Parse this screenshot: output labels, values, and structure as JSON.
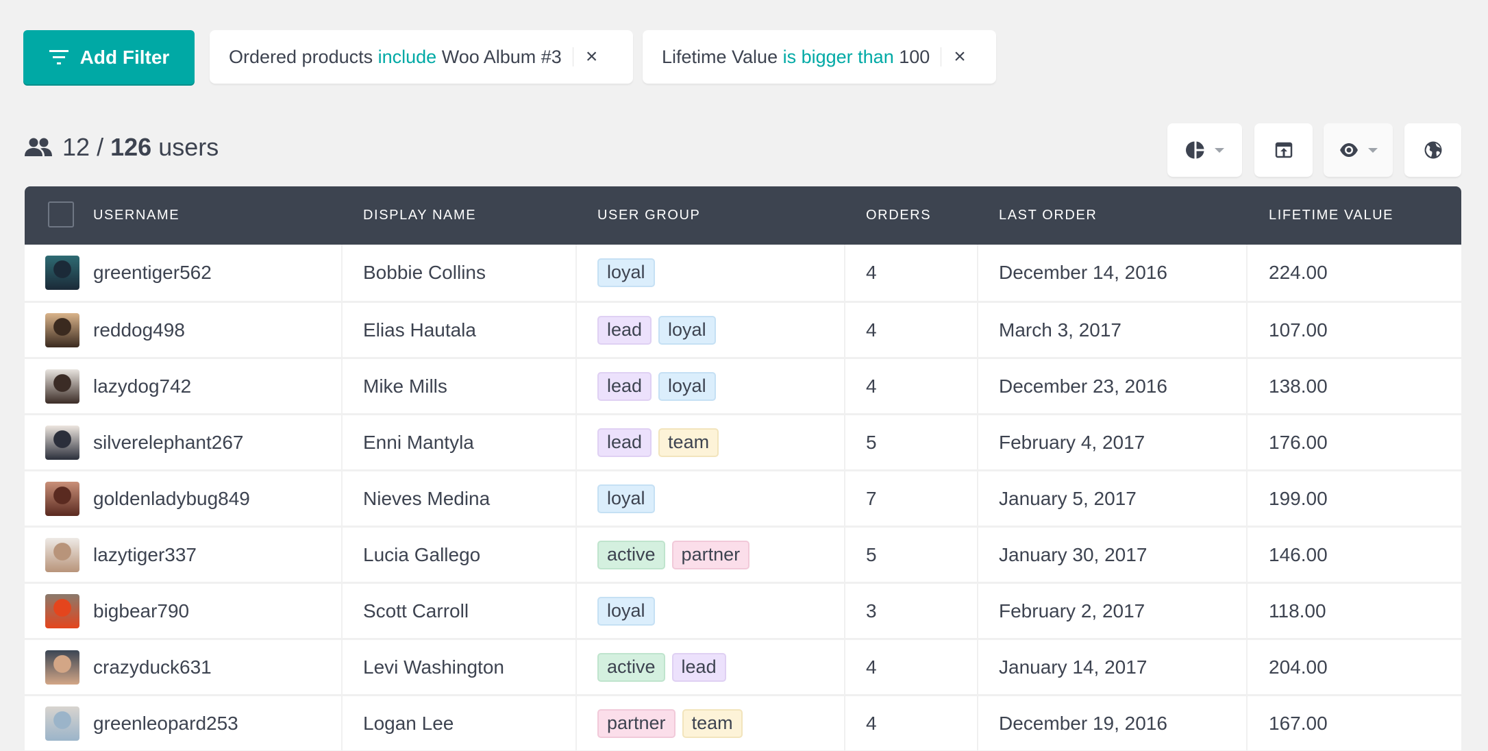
{
  "filter_bar": {
    "add_filter_label": "Add Filter",
    "filters": [
      {
        "field": "Ordered products",
        "operator": "include",
        "value": "Woo Album #3",
        "remove": "×"
      },
      {
        "field": "Lifetime Value",
        "operator": "is bigger than",
        "value": "100",
        "remove": "×"
      }
    ]
  },
  "summary": {
    "shown": "12",
    "separator": "/",
    "total": "126",
    "unit": "users"
  },
  "toolbar": [
    {
      "name": "segments-button",
      "icon": "pie-chart-icon",
      "has_dropdown": true
    },
    {
      "name": "export-button",
      "icon": "export-icon",
      "has_dropdown": false
    },
    {
      "name": "column-visibility-button",
      "icon": "eye-icon",
      "has_dropdown": true
    },
    {
      "name": "geolocation-button",
      "icon": "globe-icon",
      "has_dropdown": false
    }
  ],
  "colors": {
    "accent": "#00a9a5",
    "header_bg": "#3d4450",
    "text": "#3d4350",
    "tag_loyal": "#dbeefc",
    "tag_lead": "#ece1fc",
    "tag_team": "#fdf3d8",
    "tag_active": "#d4f0df",
    "tag_partner": "#fbdeea"
  },
  "table": {
    "columns": [
      "USERNAME",
      "DISPLAY NAME",
      "USER GROUP",
      "ORDERS",
      "LAST ORDER",
      "LIFETIME VALUE"
    ],
    "rows": [
      {
        "username": "greentiger562",
        "display_name": "Bobbie Collins",
        "groups": [
          "loyal"
        ],
        "orders": "4",
        "last_order": "December 14, 2016",
        "lifetime_value": "224.00",
        "avatar_colors": [
          "#2e6b73",
          "#1b2a38"
        ]
      },
      {
        "username": "reddog498",
        "display_name": "Elias Hautala",
        "groups": [
          "lead",
          "loyal"
        ],
        "orders": "4",
        "last_order": "March 3, 2017",
        "lifetime_value": "107.00",
        "avatar_colors": [
          "#d9b38a",
          "#3a2a1f"
        ]
      },
      {
        "username": "lazydog742",
        "display_name": "Mike Mills",
        "groups": [
          "lead",
          "loyal"
        ],
        "orders": "4",
        "last_order": "December 23, 2016",
        "lifetime_value": "138.00",
        "avatar_colors": [
          "#e8e4df",
          "#3b2c26"
        ]
      },
      {
        "username": "silverelephant267",
        "display_name": "Enni Mantyla",
        "groups": [
          "lead",
          "team"
        ],
        "orders": "5",
        "last_order": "February 4, 2017",
        "lifetime_value": "176.00",
        "avatar_colors": [
          "#ede6df",
          "#2b2f3b"
        ]
      },
      {
        "username": "goldenladybug849",
        "display_name": "Nieves Medina",
        "groups": [
          "loyal"
        ],
        "orders": "7",
        "last_order": "January 5, 2017",
        "lifetime_value": "199.00",
        "avatar_colors": [
          "#c98f78",
          "#5a2a20"
        ]
      },
      {
        "username": "lazytiger337",
        "display_name": "Lucia Gallego",
        "groups": [
          "active",
          "partner"
        ],
        "orders": "5",
        "last_order": "January 30, 2017",
        "lifetime_value": "146.00",
        "avatar_colors": [
          "#eeeae6",
          "#b8947a"
        ]
      },
      {
        "username": "bigbear790",
        "display_name": "Scott Carroll",
        "groups": [
          "loyal"
        ],
        "orders": "3",
        "last_order": "February 2, 2017",
        "lifetime_value": "118.00",
        "avatar_colors": [
          "#8a7a6c",
          "#e4451d"
        ]
      },
      {
        "username": "crazyduck631",
        "display_name": "Levi Washington",
        "groups": [
          "active",
          "lead"
        ],
        "orders": "4",
        "last_order": "January 14, 2017",
        "lifetime_value": "204.00",
        "avatar_colors": [
          "#3b4654",
          "#d3a686"
        ]
      },
      {
        "username": "greenleopard253",
        "display_name": "Logan Lee",
        "groups": [
          "partner",
          "team"
        ],
        "orders": "4",
        "last_order": "December 19, 2016",
        "lifetime_value": "167.00",
        "avatar_colors": [
          "#d8d4cf",
          "#9bb4c9"
        ]
      }
    ]
  }
}
